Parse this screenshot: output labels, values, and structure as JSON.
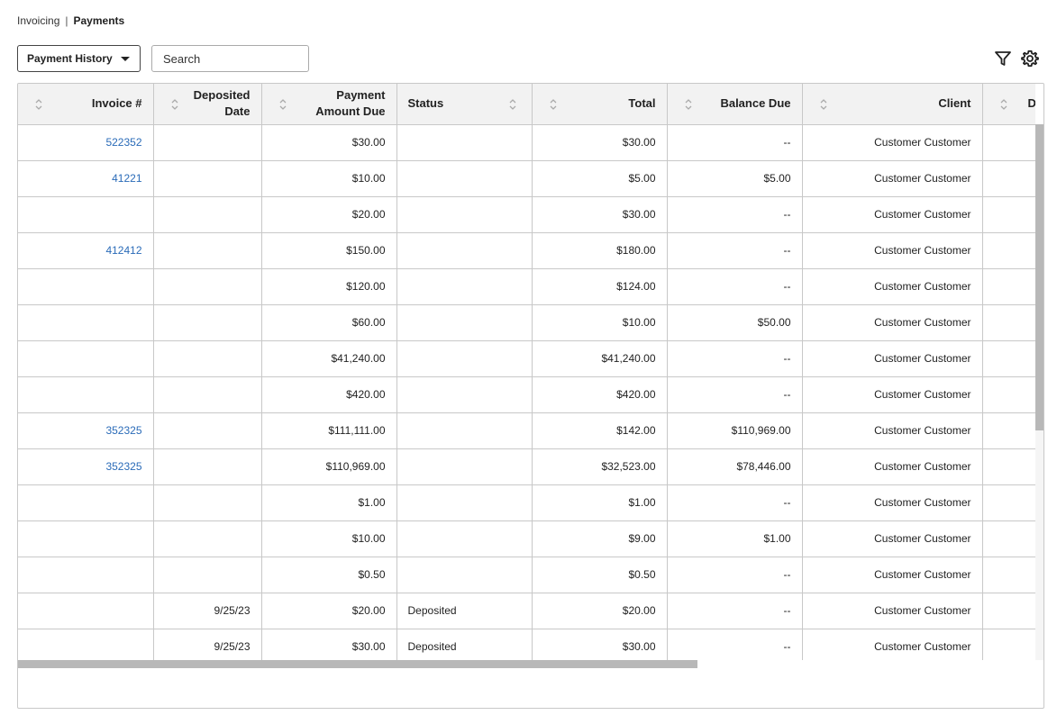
{
  "breadcrumb": {
    "parent": "Invoicing",
    "separator": "|",
    "current": "Payments"
  },
  "toolbar": {
    "view_dropdown_label": "Payment History",
    "search_placeholder": "Search",
    "filter_icon": "filter-funnel-icon",
    "settings_icon": "gear-icon"
  },
  "table": {
    "columns": [
      {
        "label": "Invoice #"
      },
      {
        "label_line1": "Deposited",
        "label_line2": "Date"
      },
      {
        "label_line1": "Payment",
        "label_line2": "Amount Due"
      },
      {
        "label": "Status"
      },
      {
        "label": "Total"
      },
      {
        "label": "Balance Due"
      },
      {
        "label": "Client"
      },
      {
        "label": "Du"
      }
    ],
    "rows": [
      {
        "invoice": "522352",
        "deposited": "",
        "payment": "$30.00",
        "status": "",
        "total": "$30.00",
        "balance": "--",
        "client": "Customer Customer"
      },
      {
        "invoice": "41221",
        "deposited": "",
        "payment": "$10.00",
        "status": "",
        "total": "$5.00",
        "balance": "$5.00",
        "client": "Customer Customer"
      },
      {
        "invoice": "",
        "deposited": "",
        "payment": "$20.00",
        "status": "",
        "total": "$30.00",
        "balance": "--",
        "client": "Customer Customer"
      },
      {
        "invoice": "412412",
        "deposited": "",
        "payment": "$150.00",
        "status": "",
        "total": "$180.00",
        "balance": "--",
        "client": "Customer Customer"
      },
      {
        "invoice": "",
        "deposited": "",
        "payment": "$120.00",
        "status": "",
        "total": "$124.00",
        "balance": "--",
        "client": "Customer Customer"
      },
      {
        "invoice": "",
        "deposited": "",
        "payment": "$60.00",
        "status": "",
        "total": "$10.00",
        "balance": "$50.00",
        "client": "Customer Customer"
      },
      {
        "invoice": "",
        "deposited": "",
        "payment": "$41,240.00",
        "status": "",
        "total": "$41,240.00",
        "balance": "--",
        "client": "Customer Customer"
      },
      {
        "invoice": "",
        "deposited": "",
        "payment": "$420.00",
        "status": "",
        "total": "$420.00",
        "balance": "--",
        "client": "Customer Customer"
      },
      {
        "invoice": "352325",
        "deposited": "",
        "payment": "$111,111.00",
        "status": "",
        "total": "$142.00",
        "balance": "$110,969.00",
        "client": "Customer Customer"
      },
      {
        "invoice": "352325",
        "deposited": "",
        "payment": "$110,969.00",
        "status": "",
        "total": "$32,523.00",
        "balance": "$78,446.00",
        "client": "Customer Customer"
      },
      {
        "invoice": "",
        "deposited": "",
        "payment": "$1.00",
        "status": "",
        "total": "$1.00",
        "balance": "--",
        "client": "Customer Customer"
      },
      {
        "invoice": "",
        "deposited": "",
        "payment": "$10.00",
        "status": "",
        "total": "$9.00",
        "balance": "$1.00",
        "client": "Customer Customer"
      },
      {
        "invoice": "",
        "deposited": "",
        "payment": "$0.50",
        "status": "",
        "total": "$0.50",
        "balance": "--",
        "client": "Customer Customer"
      },
      {
        "invoice": "",
        "deposited": "9/25/23",
        "payment": "$20.00",
        "status": "Deposited",
        "total": "$20.00",
        "balance": "--",
        "client": "Customer Customer"
      },
      {
        "invoice": "",
        "deposited": "9/25/23",
        "payment": "$30.00",
        "status": "Deposited",
        "total": "$30.00",
        "balance": "--",
        "client": "Customer Customer"
      }
    ]
  },
  "colors": {
    "link": "#2a6bb8",
    "header_bg": "#f2f2f2",
    "border": "#c8c8c8",
    "scrollbar": "#b8b8b8"
  }
}
